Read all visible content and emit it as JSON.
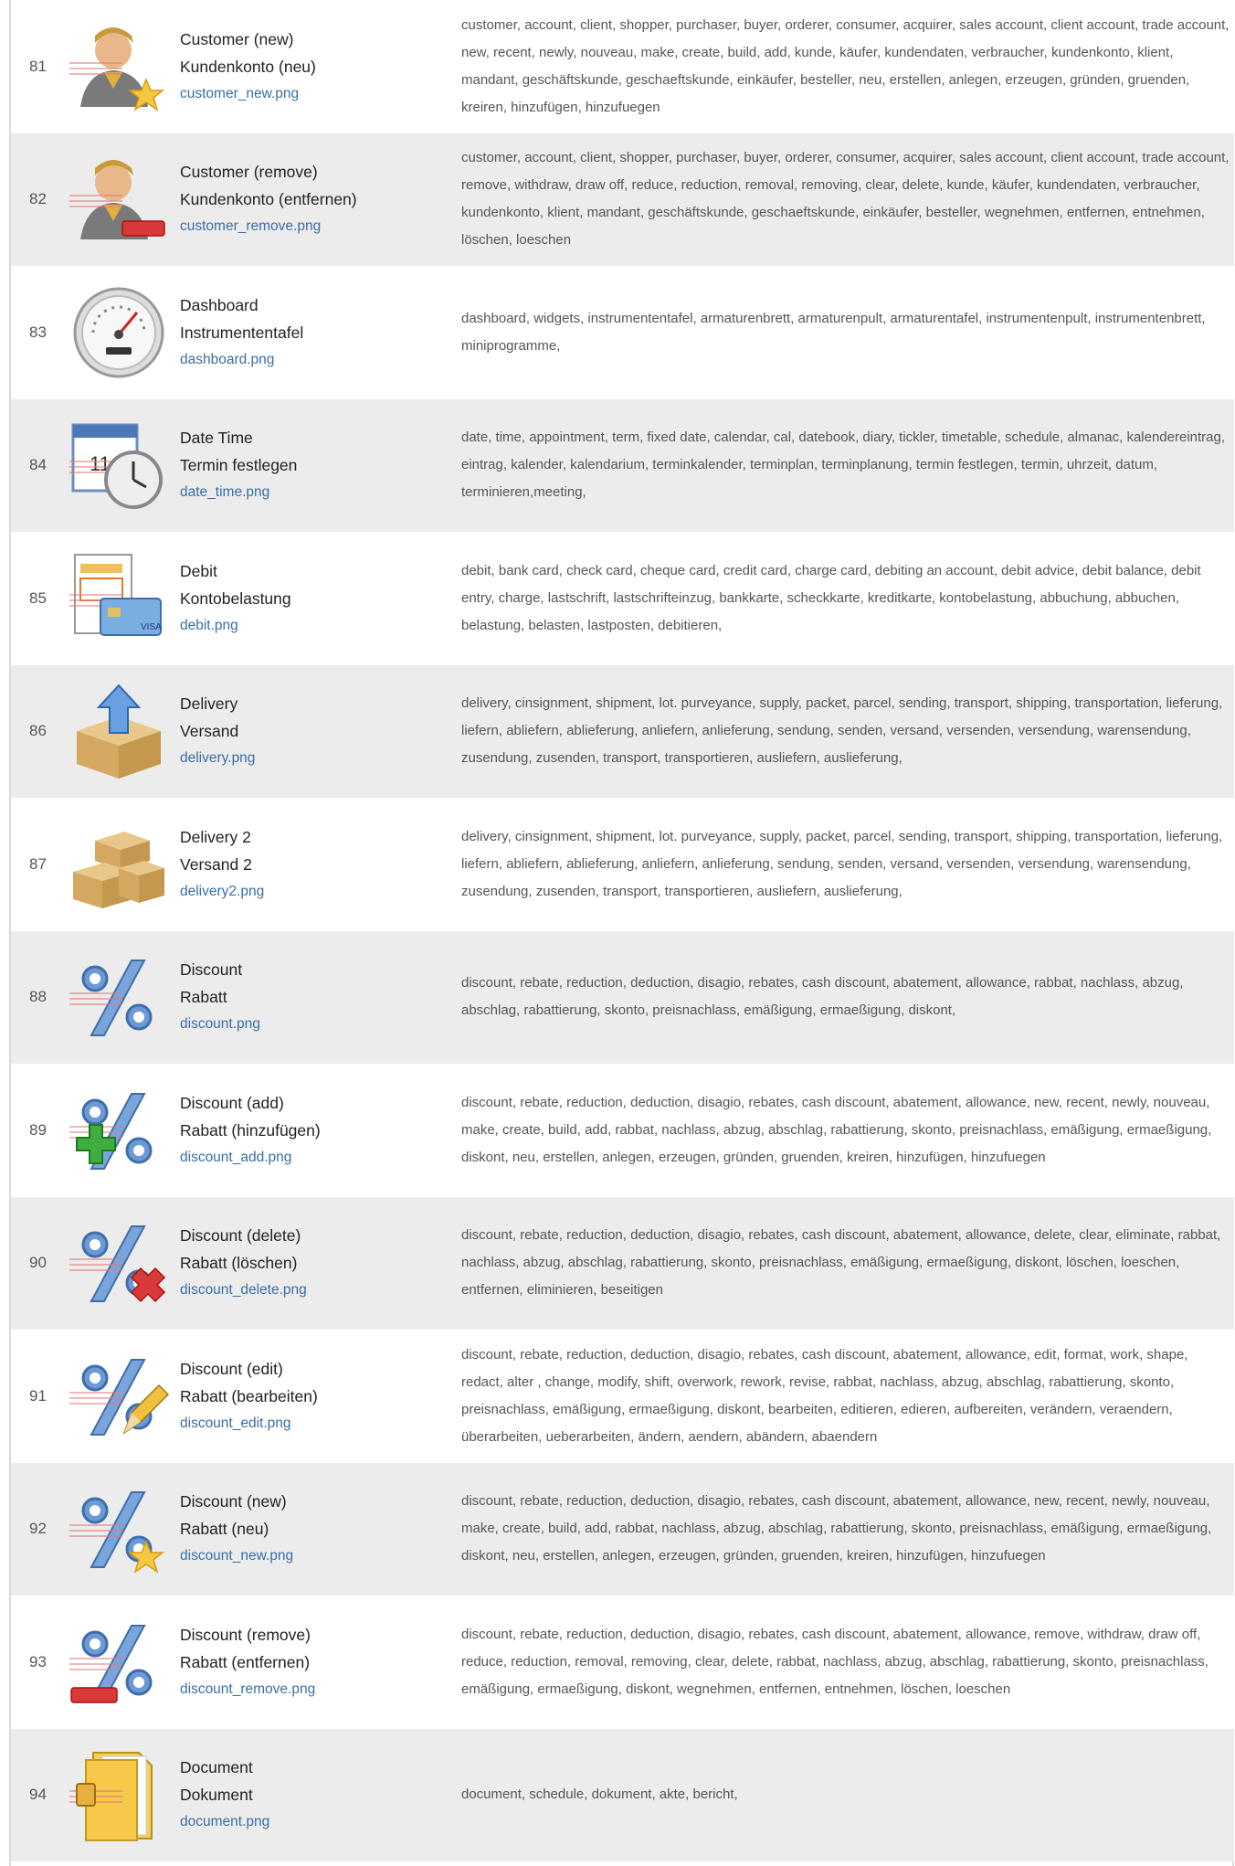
{
  "rows": [
    {
      "num": "81",
      "name_en": "Customer (new)",
      "name_de": "Kundenkonto (neu)",
      "file": "customer_new.png",
      "icon": "customer-new-icon",
      "tags": "customer, account, client, shopper, purchaser, buyer, orderer, consumer, acquirer, sales account, client account, trade account, new, recent, newly, nouveau, make, create, build, add, kunde, käufer, kundendaten, verbraucher, kundenkonto, klient, mandant, geschäftskunde, geschaeftskunde, einkäufer, besteller, neu, erstellen, anlegen, erzeugen, gründen, gruenden, kreiren, hinzufügen, hinzufuegen"
    },
    {
      "num": "82",
      "name_en": "Customer (remove)",
      "name_de": "Kundenkonto (entfernen)",
      "file": "customer_remove.png",
      "icon": "customer-remove-icon",
      "tags": "customer, account, client, shopper, purchaser, buyer, orderer, consumer, acquirer, sales account, client account, trade account, remove, withdraw, draw off, reduce, reduction, removal, removing, clear, delete, kunde, käufer, kundendaten, verbraucher, kundenkonto, klient, mandant, geschäftskunde, geschaeftskunde, einkäufer, besteller, wegnehmen, entfernen, entnehmen, löschen, loeschen"
    },
    {
      "num": "83",
      "name_en": "Dashboard",
      "name_de": "Instrumententafel",
      "file": "dashboard.png",
      "icon": "dashboard-icon",
      "tags": "dashboard, widgets, instrumententafel, armaturenbrett, armaturenpult, armaturentafel, instrumentenpult, instrumentenbrett, miniprogramme,"
    },
    {
      "num": "84",
      "name_en": "Date Time",
      "name_de": "Termin festlegen",
      "file": "date_time.png",
      "icon": "date-time-icon",
      "tags": "date, time, appointment, term, fixed date, calendar, cal, datebook, diary, tickler, timetable, schedule, almanac, kalendereintrag, eintrag, kalender, kalendarium, terminkalender, terminplan, terminplanung, termin festlegen, termin, uhrzeit, datum, terminieren,meeting,"
    },
    {
      "num": "85",
      "name_en": "Debit",
      "name_de": "Kontobelastung",
      "file": "debit.png",
      "icon": "debit-icon",
      "tags": "debit, bank card, check card, cheque card, credit card, charge card, debiting an account, debit advice, debit balance, debit entry, charge, lastschrift, lastschrifteinzug, bankkarte, scheckkarte, kreditkarte, kontobelastung, abbuchung, abbuchen, belastung, belasten, lastposten, debitieren,"
    },
    {
      "num": "86",
      "name_en": "Delivery",
      "name_de": "Versand",
      "file": "delivery.png",
      "icon": "delivery-icon",
      "tags": "delivery, cinsignment, shipment, lot. purveyance, supply, packet, parcel, sending, transport, shipping, transportation, lieferung, liefern, abliefern, ablieferung, anliefern, anlieferung, sendung, senden, versand, versenden, versendung, warensendung, zusendung, zusenden, transport, transportieren, ausliefern, auslieferung,"
    },
    {
      "num": "87",
      "name_en": "Delivery 2",
      "name_de": "Versand 2",
      "file": "delivery2.png",
      "icon": "delivery2-icon",
      "tags": "delivery, cinsignment, shipment, lot. purveyance, supply, packet, parcel, sending, transport, shipping, transportation, lieferung, liefern, abliefern, ablieferung, anliefern, anlieferung, sendung, senden, versand, versenden, versendung, warensendung, zusendung, zusenden, transport, transportieren, ausliefern, auslieferung,"
    },
    {
      "num": "88",
      "name_en": "Discount",
      "name_de": "Rabatt",
      "file": "discount.png",
      "icon": "discount-icon",
      "tags": "discount, rebate, reduction, deduction, disagio, rebates, cash discount, abatement, allowance, rabbat, nachlass, abzug, abschlag, rabattierung, skonto, preisnachlass, emäßigung, ermaeßigung, diskont,"
    },
    {
      "num": "89",
      "name_en": "Discount (add)",
      "name_de": "Rabatt (hinzufügen)",
      "file": "discount_add.png",
      "icon": "discount-add-icon",
      "tags": "discount, rebate, reduction, deduction, disagio, rebates, cash discount, abatement, allowance, new, recent, newly, nouveau, make, create, build, add, rabbat, nachlass, abzug, abschlag, rabattierung, skonto, preisnachlass, emäßigung, ermaeßigung, diskont, neu, erstellen, anlegen, erzeugen, gründen, gruenden, kreiren, hinzufügen, hinzufuegen"
    },
    {
      "num": "90",
      "name_en": "Discount (delete)",
      "name_de": "Rabatt (löschen)",
      "file": "discount_delete.png",
      "icon": "discount-delete-icon",
      "tags": "discount, rebate, reduction, deduction, disagio, rebates, cash discount, abatement, allowance, delete, clear, eliminate, rabbat, nachlass, abzug, abschlag, rabattierung, skonto, preisnachlass, emäßigung, ermaeßigung, diskont, löschen, loeschen, entfernen, eliminieren, beseitigen"
    },
    {
      "num": "91",
      "name_en": "Discount (edit)",
      "name_de": "Rabatt (bearbeiten)",
      "file": "discount_edit.png",
      "icon": "discount-edit-icon",
      "tags": "discount, rebate, reduction, deduction, disagio, rebates, cash discount, abatement, allowance, edit, format, work, shape, redact, alter , change, modify, shift, overwork, rework, revise, rabbat, nachlass, abzug, abschlag, rabattierung, skonto, preisnachlass, emäßigung, ermaeßigung, diskont, bearbeiten, editieren, edieren, aufbereiten, verändern, veraendern, überarbeiten, ueberarbeiten, ändern, aendern, abändern, abaendern"
    },
    {
      "num": "92",
      "name_en": "Discount (new)",
      "name_de": "Rabatt (neu)",
      "file": "discount_new.png",
      "icon": "discount-new-icon",
      "tags": "discount, rebate, reduction, deduction, disagio, rebates, cash discount, abatement, allowance, new, recent, newly, nouveau, make, create, build, add, rabbat, nachlass, abzug, abschlag, rabattierung, skonto, preisnachlass, emäßigung, ermaeßigung, diskont, neu, erstellen, anlegen, erzeugen, gründen, gruenden, kreiren, hinzufügen, hinzufuegen"
    },
    {
      "num": "93",
      "name_en": "Discount (remove)",
      "name_de": "Rabatt (entfernen)",
      "file": "discount_remove.png",
      "icon": "discount-remove-icon",
      "tags": "discount, rebate, reduction, deduction, disagio, rebates, cash discount, abatement, allowance, remove, withdraw, draw off, reduce, reduction, removal, removing, clear, delete, rabbat, nachlass, abzug, abschlag, rabattierung, skonto, preisnachlass, emäßigung, ermaeßigung, diskont, wegnehmen, entfernen, entnehmen, löschen, loeschen"
    },
    {
      "num": "94",
      "name_en": "Document",
      "name_de": "Dokument",
      "file": "document.png",
      "icon": "document-icon",
      "tags": "document, schedule, dokument, akte, bericht,"
    }
  ]
}
